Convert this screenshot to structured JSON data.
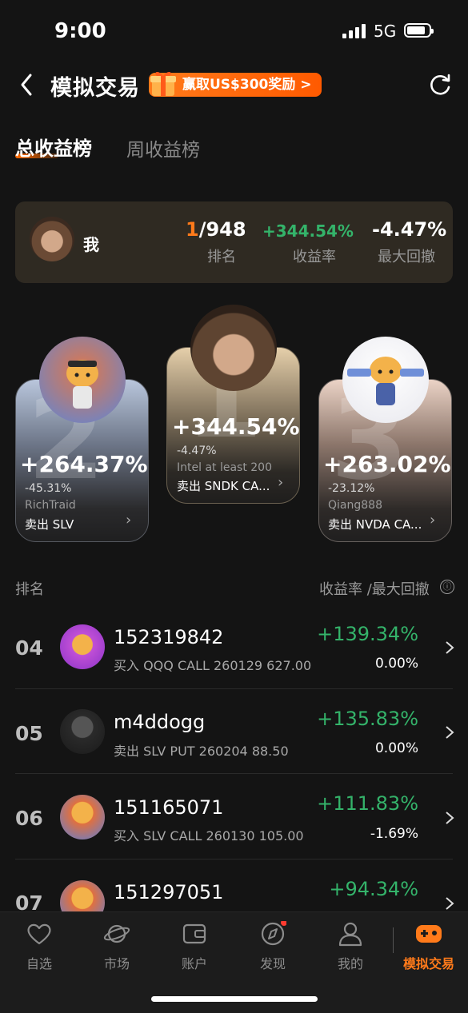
{
  "status": {
    "time": "9:00",
    "network": "5G"
  },
  "header": {
    "title": "模拟交易",
    "promo": "赢取US$300奖励 >"
  },
  "tabs": {
    "active": "总收益榜",
    "inactive": "周收益榜"
  },
  "me": {
    "name": "我",
    "rank_pos": "1",
    "rank_total": "/948",
    "rank_label": "排名",
    "return": "+344.54%",
    "return_label": "收益率",
    "drawdown": "-4.47%",
    "drawdown_label": "最大回撤"
  },
  "podium": {
    "first": {
      "num": "1",
      "return": "+344.54%",
      "drawdown": "-4.47%",
      "name": "Intel at least 200",
      "trade": "卖出 SNDK CA..."
    },
    "second": {
      "num": "2",
      "return": "+264.37%",
      "drawdown": "-45.31%",
      "name": "RichTraid",
      "trade": "卖出 SLV"
    },
    "third": {
      "num": "3",
      "return": "+263.02%",
      "drawdown": "-23.12%",
      "name": "Qiang888",
      "trade": "卖出 NVDA CA..."
    }
  },
  "list": {
    "head_rank": "排名",
    "head_metrics": "收益率 /最大回撤",
    "info_icon": "ⓘ",
    "rows": [
      {
        "rank": "04",
        "name": "152319842",
        "trade": "买入 QQQ CALL 260129 627.00",
        "return": "+139.34%",
        "drawdown": "0.00%"
      },
      {
        "rank": "05",
        "name": "m4ddogg",
        "trade": "卖出 SLV PUT 260204 88.50",
        "return": "+135.83%",
        "drawdown": "0.00%"
      },
      {
        "rank": "06",
        "name": "151165071",
        "trade": "买入 SLV CALL 260130 105.00",
        "return": "+111.83%",
        "drawdown": "-1.69%"
      },
      {
        "rank": "07",
        "name": "151297051",
        "trade": "",
        "return": "+94.34%",
        "drawdown": ""
      }
    ]
  },
  "nav": {
    "items": [
      {
        "label": "自选",
        "icon": "heart-icon"
      },
      {
        "label": "市场",
        "icon": "planet-icon"
      },
      {
        "label": "账户",
        "icon": "wallet-icon"
      },
      {
        "label": "发现",
        "icon": "compass-icon"
      },
      {
        "label": "我的",
        "icon": "person-icon"
      },
      {
        "label": "模拟交易",
        "icon": "gamepad-icon"
      }
    ]
  },
  "colors": {
    "accent": "#ff7a1a",
    "gain": "#34b36a",
    "background": "#141414"
  }
}
